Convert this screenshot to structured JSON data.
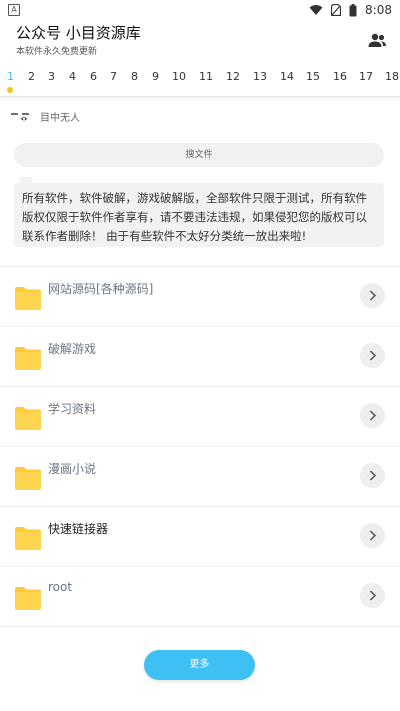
{
  "status_bar": {
    "time": "8:08",
    "left_icon": "A"
  },
  "header": {
    "title": "公众号 小目资源库",
    "subtitle": "本软件永久免费更新"
  },
  "tabs": {
    "items": [
      "1",
      "2",
      "3",
      "4",
      "6",
      "7",
      "8",
      "9",
      "10",
      "11",
      "12",
      "13",
      "14",
      "15",
      "16",
      "17",
      "18"
    ],
    "selected": "1",
    "accent_color": "#3fb8d6",
    "dot_color": "#f5c518"
  },
  "author": {
    "name": "目中无人"
  },
  "search": {
    "placeholder": "搜文件"
  },
  "notice": {
    "text": "所有软件，软件破解，游戏破解版，全部软件只限于测试，所有软件版权仅限于软件作者享有，请不要违法违规，如果侵犯您的版权可以联系作者删除！ 由于有些软件不太好分类统一放出来啦!"
  },
  "folders": [
    {
      "label": "网站源码[各种源码]",
      "color": "#6a7684"
    },
    {
      "label": "破解游戏",
      "color": "#6a7684"
    },
    {
      "label": "学习资料",
      "color": "#6a7684"
    },
    {
      "label": "漫画小说",
      "color": "#6a7684"
    },
    {
      "label": "快速链接器",
      "color": "#222222"
    },
    {
      "label": "root",
      "color": "#6a7684"
    }
  ],
  "more_button": {
    "label": "更多",
    "color": "#3ec0f5"
  }
}
